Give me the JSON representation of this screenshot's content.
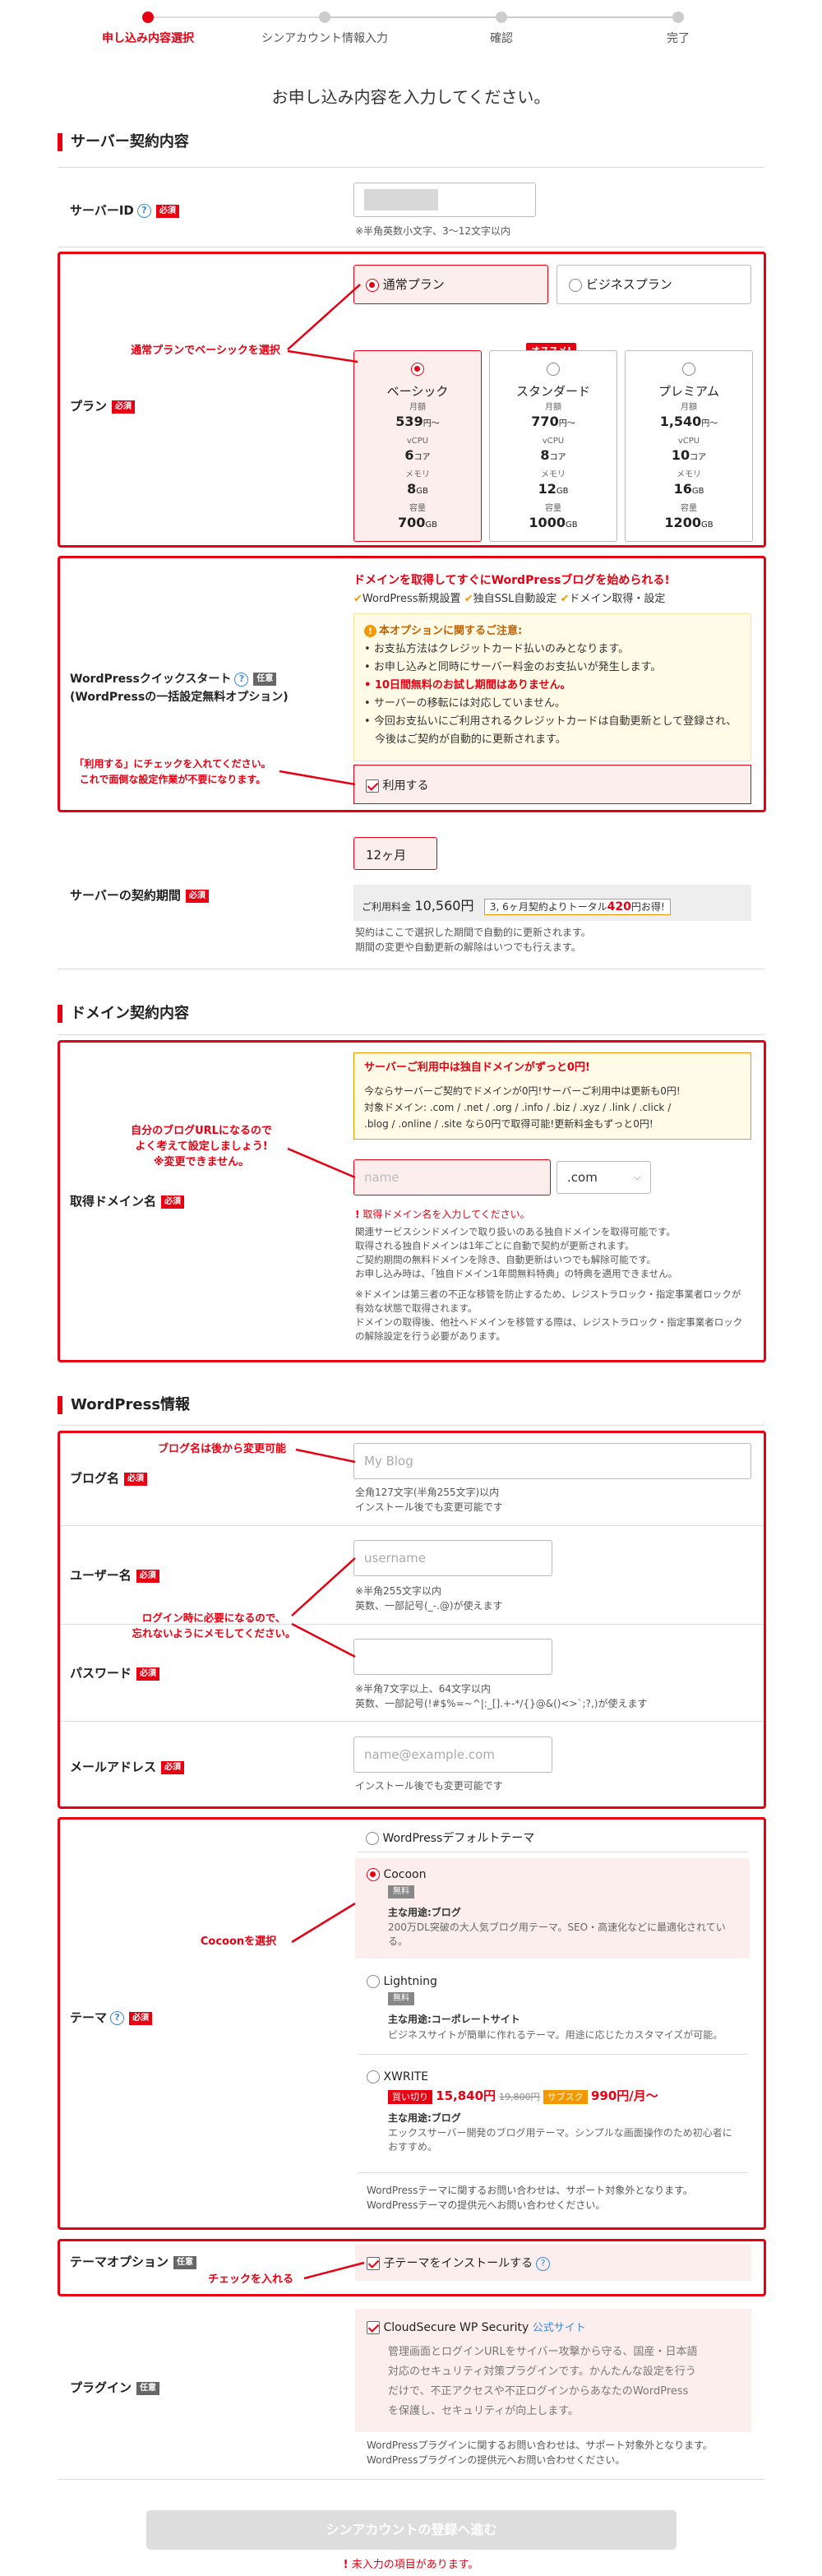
{
  "steps": [
    {
      "label": "申し込み内容選択",
      "active": true
    },
    {
      "label": "シンアカウント情報入力"
    },
    {
      "label": "確認"
    },
    {
      "label": "完了"
    }
  ],
  "page_title": "お申し込み内容を入力してください。",
  "server": {
    "heading": "サーバー契約内容",
    "id_label": "サーバーID",
    "required": "必須",
    "optional": "任意",
    "id_note": "※半角英数小文字、3〜12文字以内",
    "plan_label": "プラン",
    "plan_normal": "通常プラン",
    "plan_business": "ビジネスプラン",
    "recommend": "オススメ!",
    "plans": [
      {
        "name": "ベーシック",
        "price_label": "月額",
        "price": "539",
        "price_unit": "円〜",
        "cpu_label": "vCPU",
        "cpu": "6",
        "cpu_unit": "コア",
        "mem_label": "メモリ",
        "mem": "8",
        "mem_unit": "GB",
        "disk_label": "容量",
        "disk": "700",
        "disk_unit": "GB"
      },
      {
        "name": "スタンダード",
        "price_label": "月額",
        "price": "770",
        "price_unit": "円〜",
        "cpu_label": "vCPU",
        "cpu": "8",
        "cpu_unit": "コア",
        "mem_label": "メモリ",
        "mem": "12",
        "mem_unit": "GB",
        "disk_label": "容量",
        "disk": "1000",
        "disk_unit": "GB"
      },
      {
        "name": "プレミアム",
        "price_label": "月額",
        "price": "1,540",
        "price_unit": "円〜",
        "cpu_label": "vCPU",
        "cpu": "10",
        "cpu_unit": "コア",
        "mem_label": "メモリ",
        "mem": "16",
        "mem_unit": "GB",
        "disk_label": "容量",
        "disk": "1200",
        "disk_unit": "GB"
      }
    ],
    "quick_label": "WordPressクイックスタート",
    "quick_sub": "(WordPressの一括設定無料オプション)",
    "quick_head": "ドメインを取得してすぐにWordPressブログを始められる!",
    "quick_feats": [
      "WordPress新規設置",
      "独自SSL自動設定",
      "ドメイン取得・設定"
    ],
    "caution_title": "本オプションに関するご注意:",
    "cautions": [
      "お支払方法はクレジットカード払いのみとなります。",
      "お申し込みと同時にサーバー料金のお支払いが発生します。",
      "10日間無料のお試し期間はありません。",
      "サーバーの移転には対応していません。",
      "今回お支払いにご利用されるクレジットカードは自動更新として登録され、今後はご契約が自動的に更新されます。"
    ],
    "use_label": "利用する",
    "period_label": "サーバーの契約期間",
    "period_value": "12ヶ月",
    "fee_label": "ご利用料金",
    "fee_value": "10,560円",
    "fee_promo_a": "3, 6ヶ月契約よりトータル",
    "fee_promo_b": "420",
    "fee_promo_c": "円お得!",
    "period_notes": [
      "契約はここで選択した期間で自動的に更新されます。",
      "期間の変更や自動更新の解除はいつでも行えます。"
    ]
  },
  "domain": {
    "heading": "ドメイン契約内容",
    "label": "取得ドメイン名",
    "free_title": "サーバーご利用中は独自ドメインがずっと0円!",
    "free_lines": [
      "今ならサーバーご契約でドメインが0円!サーバーご利用中は更新も0円!",
      "対象ドメイン: .com / .net / .org / .info / .biz / .xyz / .link / .click /",
      ".blog / .online / .site なら0円で取得可能!更新料金もずっと0円!"
    ],
    "name_placeholder": "name",
    "tld": ".com",
    "error": "取得ドメイン名を入力してください。",
    "notes": [
      "関連サービスシンドメインで取り扱いのある独自ドメインを取得可能です。",
      "取得される独自ドメインは1年ごとに自動で契約が更新されます。",
      "ご契約期間の無料ドメインを除き、自動更新はいつでも解除可能です。",
      "お申し込み時は、「独自ドメイン1年間無料特典」の特典を適用できません。"
    ],
    "notes2": [
      "※ドメインは第三者の不正な移管を防止するため、レジストラロック・指定事業者ロックが有効な状態で取得されます。",
      "ドメインの取得後、他社へドメインを移管する際は、レジストラロック・指定事業者ロックの解除設定を行う必要があります。"
    ]
  },
  "wp": {
    "heading": "WordPress情報",
    "blog_label": "ブログ名",
    "blog_placeholder": "My Blog",
    "blog_notes": [
      "全角127文字(半角255文字)以内",
      "インストール後でも変更可能です"
    ],
    "user_label": "ユーザー名",
    "user_placeholder": "username",
    "user_notes": [
      "※半角255文字以内",
      "英数、一部記号(_-.@)が使えます"
    ],
    "pass_label": "パスワード",
    "pass_notes": [
      "※半角7文字以上、64文字以内",
      "英数、一部記号(!#$%=~^|:_[].+-*/{}@&()<>`;?,)が使えます"
    ],
    "mail_label": "メールアドレス",
    "mail_placeholder": "name@example.com",
    "mail_notes": [
      "インストール後でも変更可能です"
    ],
    "theme_label": "テーマ",
    "theme_default": "WordPressデフォルトテーマ",
    "themes": [
      {
        "name": "Cocoon",
        "badge": "無料",
        "use": "主な用途:ブログ",
        "desc": "200万DL突破の大人気ブログ用テーマ。SEO・高速化などに最適化されている。"
      },
      {
        "name": "Lightning",
        "badge": "無料",
        "use": "主な用途:コーポレートサイト",
        "desc": "ビジネスサイトが簡単に作れるテーマ。用途に応じたカスタマイズが可能。"
      },
      {
        "name": "XWRITE",
        "sale": "買い切り",
        "sale_price": "15,840円",
        "old_price": "19,800円",
        "sub": "サブスク",
        "sub_price": "990円/月〜",
        "use": "主な用途:ブログ",
        "desc": "エックスサーバー開発のブログ用テーマ。シンプルな画面操作のため初心者におすすめ。"
      }
    ],
    "theme_notes": [
      "WordPressテーマに関するお問い合わせは、サポート対象外となります。",
      "WordPressテーマの提供元へお問い合わせください。"
    ],
    "theme_opt_label": "テーマオプション",
    "child_label": "子テーマをインストールする",
    "plugin_label": "プラグイン",
    "plugin_name": "CloudSecure WP Security",
    "plugin_link": "公式サイト",
    "plugin_desc": [
      "管理画面とログインURLをサイバー攻撃から守る、国産・日本語",
      "対応のセキュリティ対策プラグインです。かんたんな設定を行う",
      "だけで、不正アクセスや不正ログインからあなたのWordPress",
      "を保護し、セキュリティが向上します。"
    ],
    "plugin_notes": [
      "WordPressプラグインに関するお問い合わせは、サポート対象外となります。",
      "WordPressプラグインの提供元へお問い合わせください。"
    ]
  },
  "submit": "シンアカウントの登録へ進む",
  "submit_error": "未入力の項目があります。",
  "annotations": {
    "plan": "通常プランでベーシックを選択",
    "quick": [
      "「利用する」にチェックを入れてください。",
      "これで面倒な設定作業が不要になります。"
    ],
    "domain": [
      "自分のブログURLになるので",
      "よく考えて設定しましょう!",
      "※変更できません。"
    ],
    "blog": "ブログ名は後から変更可能",
    "login": [
      "ログイン時に必要になるので、",
      "忘れないようにメモしてください。"
    ],
    "theme": "Cocoonを選択",
    "child": "チェックを入れる"
  },
  "colors": {
    "accent": "#e60012",
    "pink": "#fdeeee",
    "cream": "#fffbe6",
    "orange": "#f39800"
  }
}
